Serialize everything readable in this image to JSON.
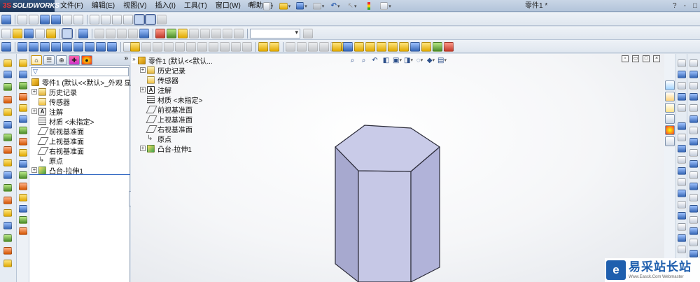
{
  "app": {
    "logo_text": "SOLIDWORKS",
    "logo_prefix": "3S",
    "document_title": "零件1 *",
    "window_controls": [
      "?",
      "-",
      "□"
    ]
  },
  "menu": [
    "文件(F)",
    "编辑(E)",
    "视图(V)",
    "插入(I)",
    "工具(T)",
    "窗口(W)",
    "帮助(H)"
  ],
  "feature_manager": {
    "tree_header": "零件1 (默认<<默认>_外观 显",
    "items": [
      {
        "label": "历史记录",
        "icon": "history-icon",
        "expandable": true
      },
      {
        "label": "传感器",
        "icon": "sensor-icon",
        "expandable": false
      },
      {
        "label": "注解",
        "icon": "annotation-icon",
        "expandable": true
      },
      {
        "label": "材质 <未指定>",
        "icon": "material-icon",
        "expandable": false
      },
      {
        "label": "前视基准面",
        "icon": "plane-icon",
        "expandable": false
      },
      {
        "label": "上视基准面",
        "icon": "plane-icon",
        "expandable": false
      },
      {
        "label": "右视基准面",
        "icon": "plane-icon",
        "expandable": false
      },
      {
        "label": "原点",
        "icon": "origin-icon",
        "expandable": false
      },
      {
        "label": "凸台-拉伸1",
        "icon": "extrude-icon",
        "expandable": true
      }
    ],
    "tabs": [
      "feature-manager-tab",
      "property-manager-tab",
      "configuration-manager-tab",
      "dim-xpert-tab",
      "display-manager-tab"
    ]
  },
  "graphics_tree": {
    "header": "零件1 (默认<<默认...",
    "items": [
      {
        "label": "历史记录",
        "icon": "history-icon",
        "expandable": true
      },
      {
        "label": "传感器",
        "icon": "sensor-icon",
        "expandable": false
      },
      {
        "label": "注解",
        "icon": "annotation-icon",
        "expandable": true
      },
      {
        "label": "材质 <未指定>",
        "icon": "material-icon",
        "expandable": false
      },
      {
        "label": "前视基准面",
        "icon": "plane-icon",
        "expandable": false
      },
      {
        "label": "上视基准面",
        "icon": "plane-icon",
        "expandable": false
      },
      {
        "label": "右视基准面",
        "icon": "plane-icon",
        "expandable": false
      },
      {
        "label": "原点",
        "icon": "origin-icon",
        "expandable": false
      },
      {
        "label": "凸台-拉伸1",
        "icon": "extrude-icon",
        "expandable": true
      }
    ]
  },
  "model": {
    "shape": "hexagonal prism",
    "face_top": "#c9cbe8",
    "face_left": "#a7a9cf",
    "face_front": "#c6c8e6",
    "face_right": "#b1b3d9",
    "edge": "#2c2c3a"
  },
  "watermark": {
    "logo": "e",
    "name": "易采站长站",
    "subtitle": "Www.Easck.Com Webmaster"
  },
  "colors": {
    "accent": "#2f66c2",
    "title_bar": "#b3c4da",
    "graphics_bg": "#f5f6f8"
  }
}
